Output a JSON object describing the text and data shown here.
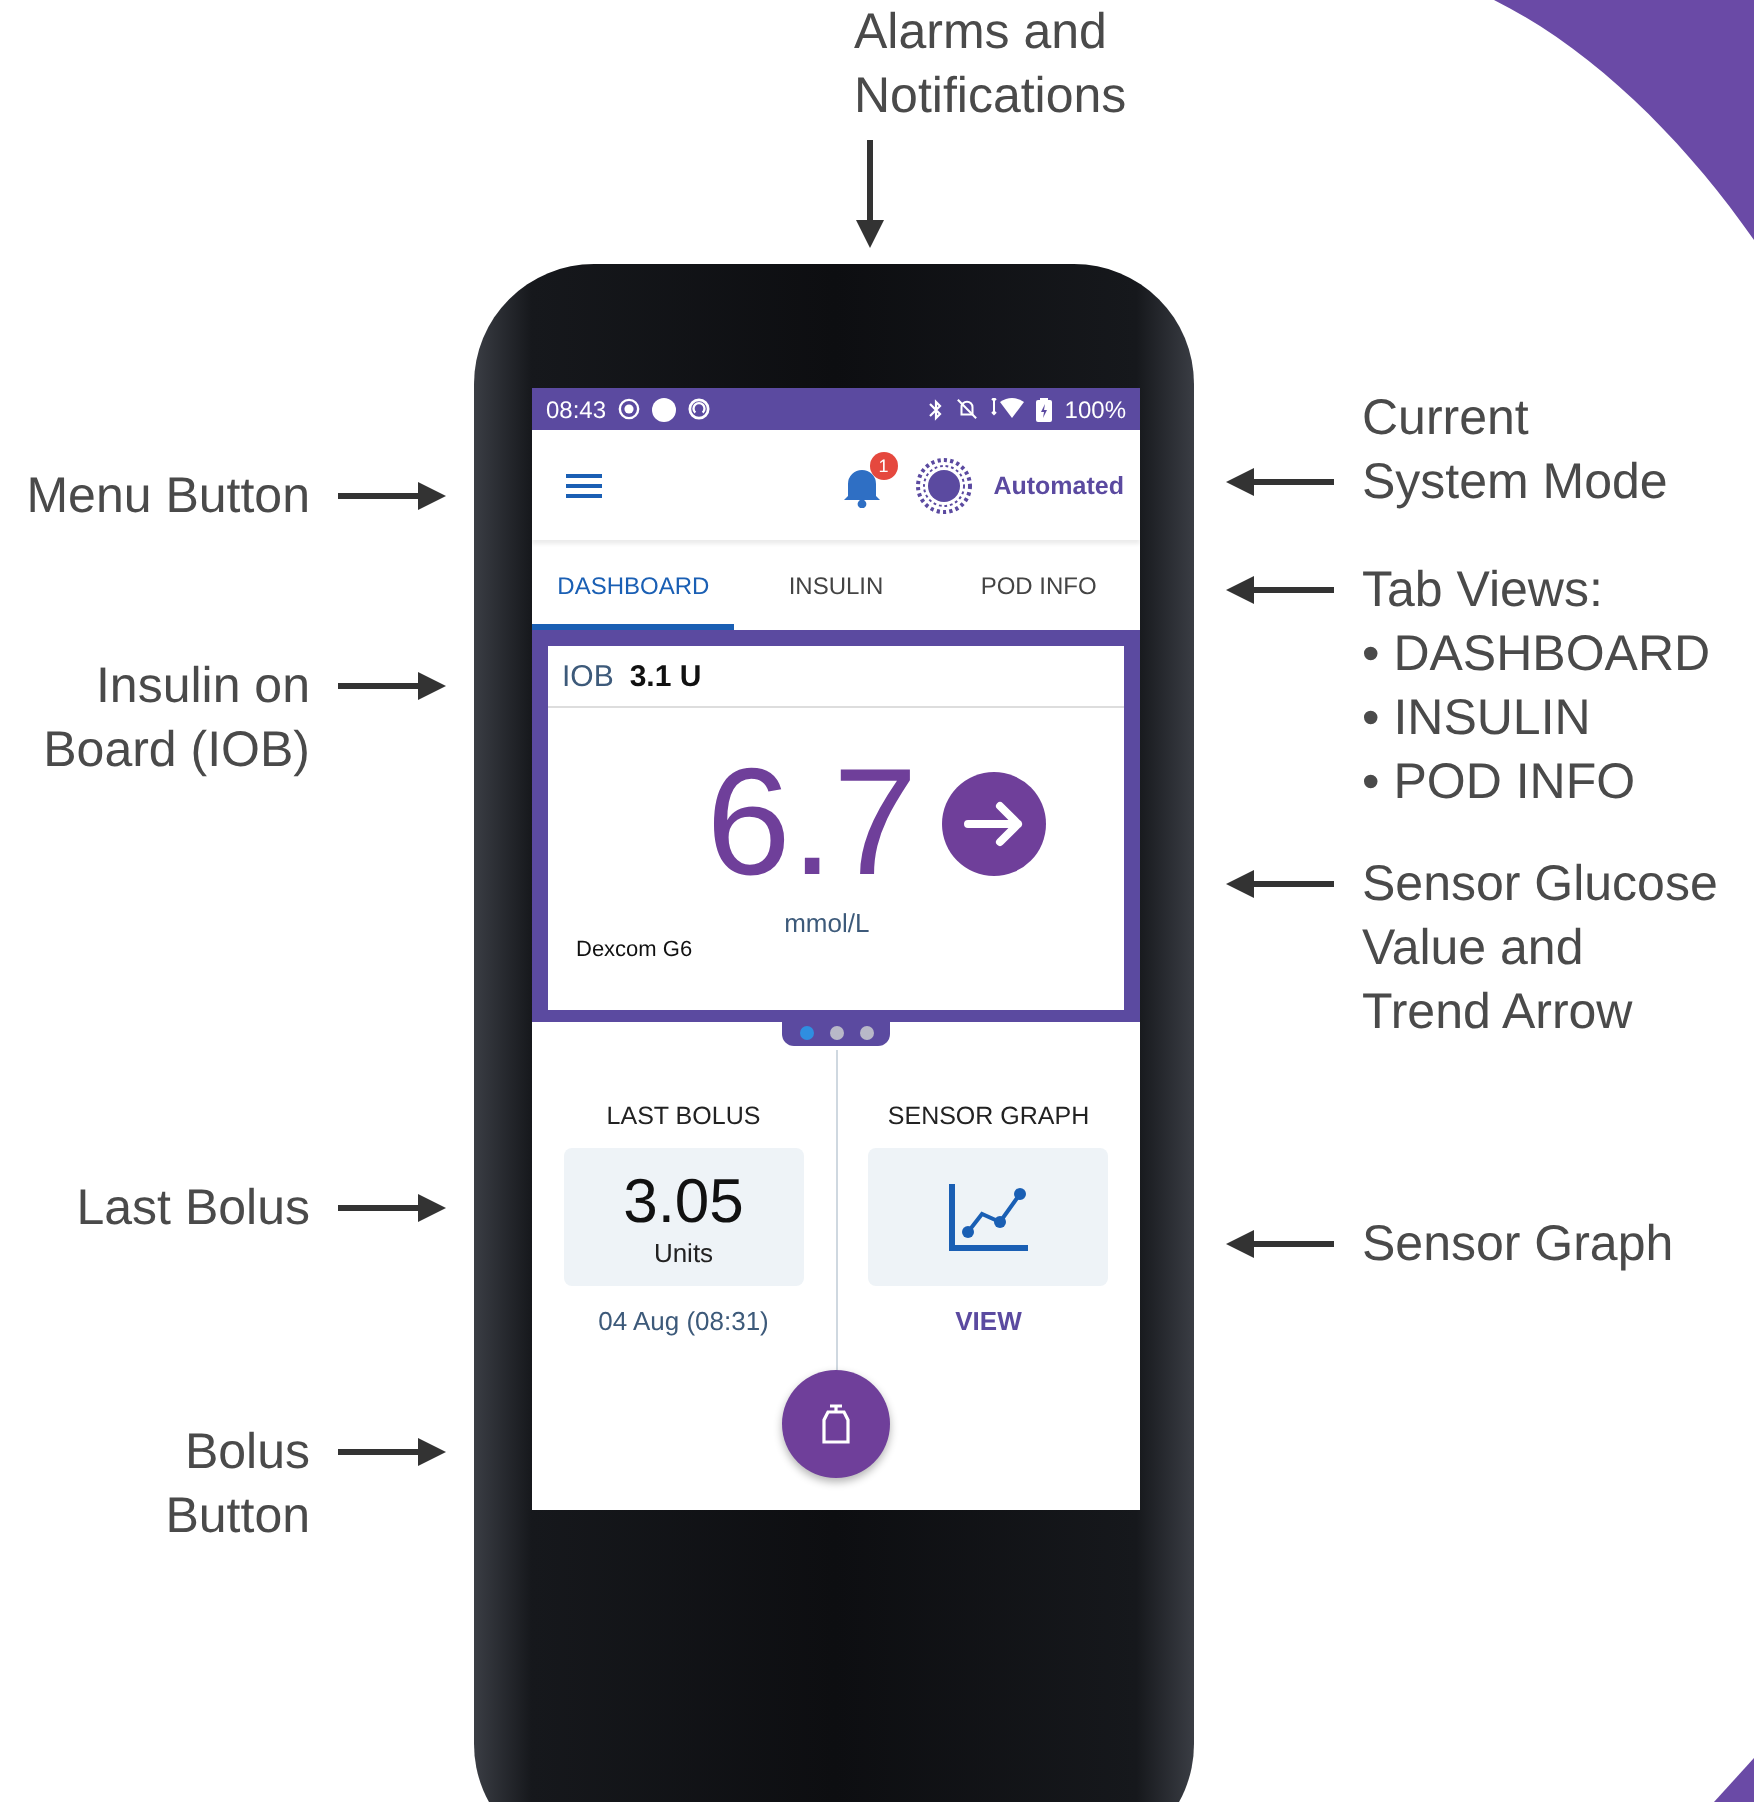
{
  "top_callout": {
    "lines": [
      "Alarms and",
      "Notifications"
    ]
  },
  "left_callouts": [
    {
      "lines": [
        "Menu Button"
      ]
    },
    {
      "lines": [
        "Insulin on",
        "Board (IOB)"
      ]
    },
    {
      "lines": [
        "Last Bolus"
      ]
    },
    {
      "lines": [
        "Bolus",
        "Button"
      ]
    }
  ],
  "right_callouts": [
    {
      "lines": [
        "Current",
        "System Mode"
      ]
    },
    {
      "lines": [
        "Tab Views:",
        "• DASHBOARD",
        "• INSULIN",
        "• POD INFO"
      ]
    },
    {
      "lines": [
        "Sensor Glucose",
        "Value and",
        "Trend Arrow"
      ]
    },
    {
      "lines": [
        "Sensor Graph"
      ]
    }
  ],
  "status_bar": {
    "time": "08:43",
    "battery": "100%"
  },
  "header": {
    "notification_count": "1",
    "mode": "Automated"
  },
  "tabs": [
    {
      "label": "DASHBOARD",
      "selected": true
    },
    {
      "label": "INSULIN",
      "selected": false
    },
    {
      "label": "POD INFO",
      "selected": false
    }
  ],
  "iob": {
    "label": "IOB",
    "value": "3.1 U"
  },
  "glucose": {
    "value": "6.7",
    "unit": "mmol/L",
    "source": "Dexcom G6"
  },
  "pager": [
    {
      "selected": true
    },
    {
      "selected": false
    },
    {
      "selected": false
    }
  ],
  "last_bolus": {
    "title": "LAST BOLUS",
    "value": "3.05",
    "unit": "Units",
    "date": "04 Aug (08:31)"
  },
  "sensor_graph": {
    "title": "SENSOR GRAPH",
    "link": "VIEW"
  }
}
